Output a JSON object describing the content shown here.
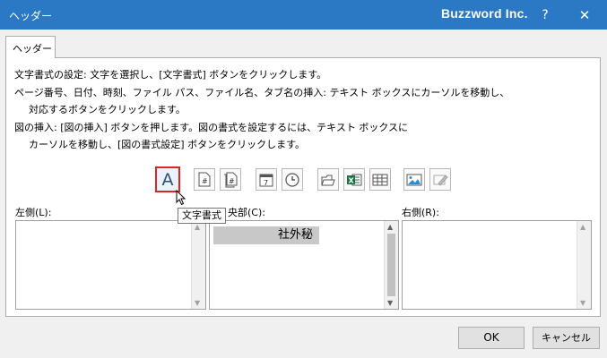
{
  "window": {
    "title": "ヘッダー",
    "document": "Buzzword Inc.",
    "help_label": "?",
    "close_label": "✕"
  },
  "tab": {
    "label": "ヘッダー"
  },
  "instructions": [
    "文字書式の設定: 文字を選択し、[文字書式] ボタンをクリックします。",
    "ページ番号、日付、時刻、ファイル パス、ファイル名、タブ名の挿入: テキスト ボックスにカーソルを移動し、",
    "対応するボタンをクリックします。",
    "図の挿入: [図の挿入] ボタンを押します。図の書式を設定するには、テキスト ボックスに",
    "カーソルを移動し、[図の書式設定] ボタンをクリックします。"
  ],
  "toolbar": {
    "format_text_glyph": "A",
    "tooltip": "文字書式",
    "buttons": [
      "format-text",
      "page-number",
      "number-of-pages",
      "current-date",
      "current-time",
      "file-path",
      "file-name",
      "sheet-name",
      "insert-picture",
      "format-picture"
    ]
  },
  "sections": {
    "left_label": "左側(L):",
    "center_label_visible": "央部(C):",
    "right_label": "右側(R):",
    "center_value": "社外秘",
    "left_value": "",
    "right_value": ""
  },
  "footer": {
    "ok_label": "OK",
    "cancel_label": "キャンセル"
  },
  "colors": {
    "titlebar": "#2b79c4",
    "selected_border": "#d62626",
    "excel_green": "#1e7145"
  }
}
